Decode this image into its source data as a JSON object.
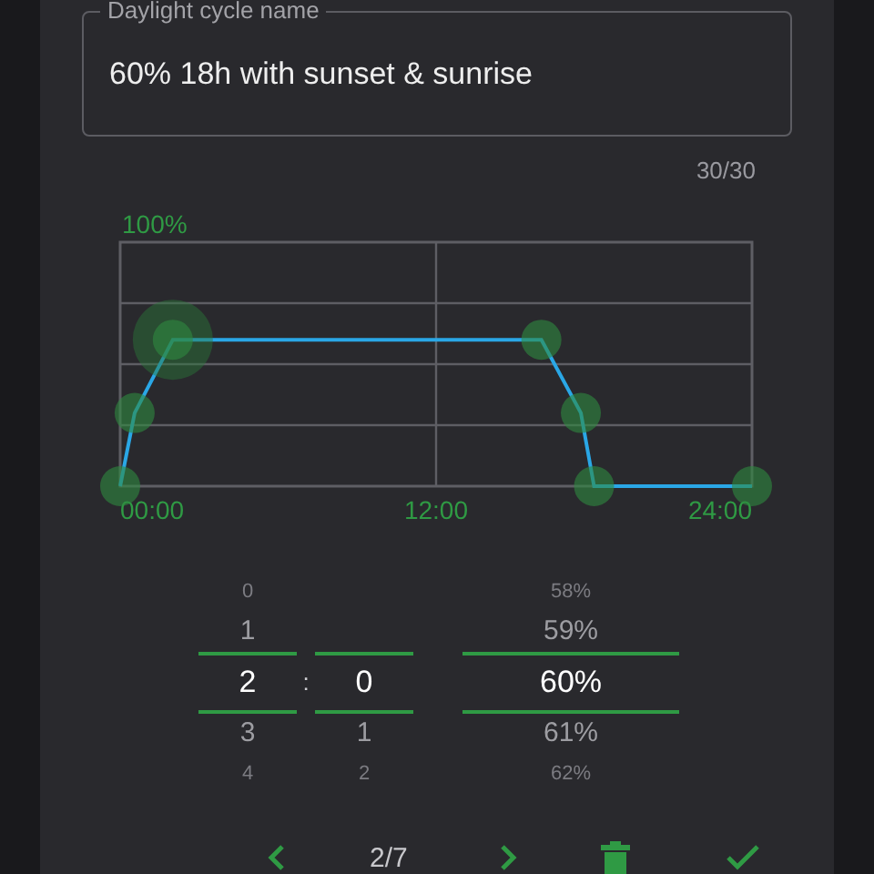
{
  "name_field": {
    "label": "Daylight cycle name",
    "value": "60% 18h with sunset & sunrise",
    "counter": "30/30"
  },
  "chart": {
    "top_label": "100%",
    "time_labels": [
      "00:00",
      "12:00",
      "24:00"
    ],
    "points": [
      {
        "selected": false
      },
      {
        "selected": false
      },
      {
        "selected": true
      },
      {
        "selected": false
      },
      {
        "selected": false
      },
      {
        "selected": false
      },
      {
        "selected": false
      }
    ]
  },
  "picker": {
    "separator": ":",
    "hours": [
      {
        "label": "0",
        "selected": false
      },
      {
        "label": "1",
        "selected": false
      },
      {
        "label": "2",
        "selected": true
      },
      {
        "label": "3",
        "selected": false
      },
      {
        "label": "4",
        "selected": false
      }
    ],
    "minutes": [
      {
        "label": "0",
        "selected": true
      },
      {
        "label": "1",
        "selected": false
      },
      {
        "label": "2",
        "selected": false
      }
    ],
    "levels": [
      {
        "label": "58%",
        "selected": false
      },
      {
        "label": "59%",
        "selected": false
      },
      {
        "label": "60%",
        "selected": true
      },
      {
        "label": "61%",
        "selected": false
      },
      {
        "label": "62%",
        "selected": false
      }
    ]
  },
  "nav": {
    "page": "2/7"
  }
}
